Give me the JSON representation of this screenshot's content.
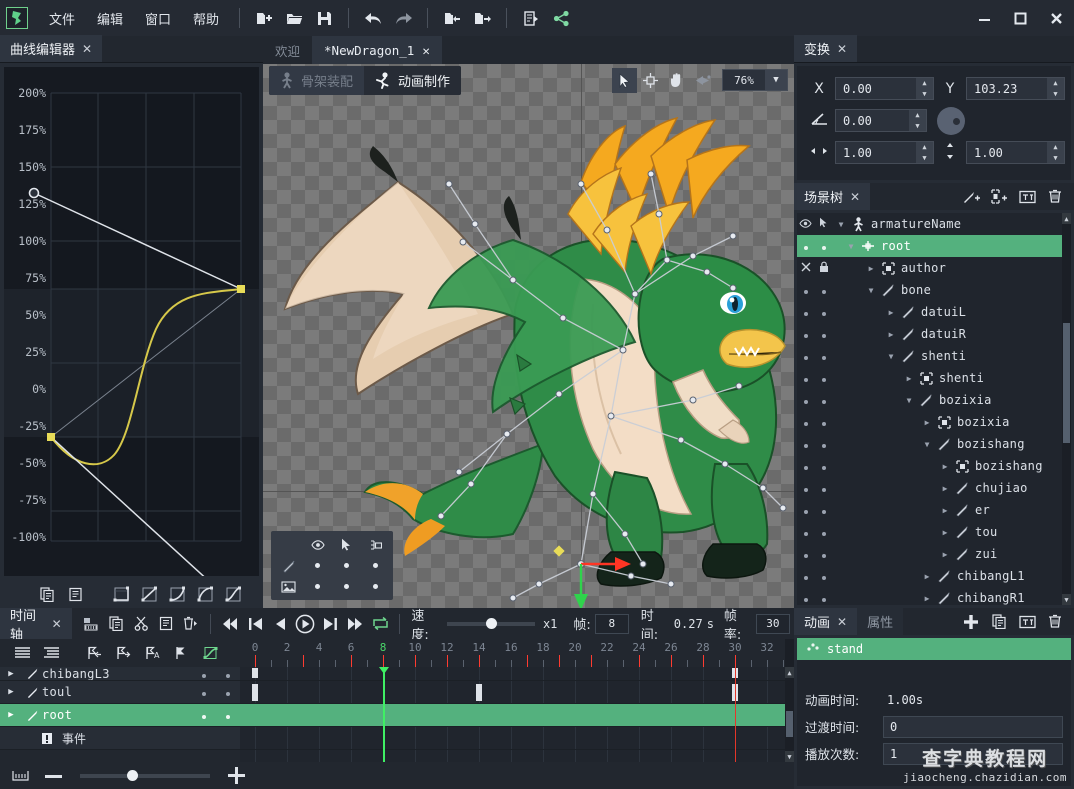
{
  "app": {
    "logo_icon": "dragonbones-logo-icon",
    "menus": [
      "文件",
      "编辑",
      "窗口",
      "帮助"
    ],
    "toolbar_icons": [
      "new-file-icon",
      "open-folder-icon",
      "save-icon",
      "undo-icon",
      "redo-icon",
      "import-icon",
      "export-icon",
      "export-document-icon",
      "share-icon"
    ],
    "window_controls": [
      "minimize",
      "maximize",
      "close"
    ]
  },
  "curve_editor": {
    "tab_label": "曲线编辑器",
    "close_icon": "close-icon",
    "y_ticks": [
      "200%",
      "175%",
      "150%",
      "125%",
      "100%",
      "75%",
      "50%",
      "25%",
      "0%",
      "-25%",
      "-50%",
      "-75%",
      "-100%"
    ],
    "toolbar_icons": [
      "copy-curve-icon",
      "paste-curve-icon",
      "linear-curve-icon",
      "ease-curve-icon",
      "ease-in-curve-icon",
      "ease-out-curve-icon",
      "ease-in-out-curve-icon"
    ],
    "handle_start_label": "150%",
    "handle_end_label": "-100%",
    "curve_color": "#d6c84a",
    "handle_color": "#d9dde3"
  },
  "center": {
    "doc_tabs": [
      {
        "label": "欢迎",
        "active": false,
        "closable": false
      },
      {
        "label": "*NewDragon_1",
        "active": true,
        "closable": true
      }
    ],
    "modes": [
      {
        "label": "骨架装配",
        "icon": "standing-person-icon",
        "active": false
      },
      {
        "label": "动画制作",
        "icon": "running-person-icon",
        "active": true
      }
    ],
    "view_tools": [
      {
        "icon": "pointer-icon",
        "selected": true
      },
      {
        "icon": "pivot-target-icon",
        "selected": false
      },
      {
        "icon": "hand-pan-icon",
        "selected": false
      },
      {
        "icon": "mesh-weight-icon",
        "selected": false
      }
    ],
    "zoom": "76%",
    "zoom_dropdown_icon": "chevron-down-icon",
    "overlay": {
      "columns": [
        "eye-visibility-icon",
        "pointer-select-icon",
        "tree-lock-icon"
      ],
      "rows": [
        "bone-icon",
        "image-icon"
      ]
    }
  },
  "transform": {
    "tab_label": "变换",
    "close_icon": "close-icon",
    "fields": [
      {
        "label": "X",
        "icon": "x-axis-icon",
        "value": "0.00"
      },
      {
        "label": "Y",
        "icon": "y-axis-icon",
        "value": "103.23"
      },
      {
        "label": "",
        "icon": "rotation-angle-icon",
        "value": "0.00"
      },
      {
        "label": "",
        "icon": "scale-x-icon",
        "value": "1.00"
      },
      {
        "label": "",
        "icon": "scale-y-icon",
        "value": "1.00"
      }
    ],
    "knob_icon": "rotation-knob-icon"
  },
  "scene_tree": {
    "tab_label": "场景树",
    "close_icon": "close-icon",
    "tools": [
      "add-bone-icon",
      "add-slot-icon",
      "add-text-icon",
      "delete-icon"
    ],
    "header": {
      "eye_icon": "eye-visibility-icon",
      "select_icon": "pointer-select-icon",
      "filter_icon": "chevron-down-icon",
      "armature_icon": "armature-icon",
      "name": "armatureName"
    },
    "nodes": [
      {
        "label": "root",
        "depth": 0,
        "icon": "root-transform-icon",
        "expanded": true,
        "selected": true,
        "visible": "dot",
        "locked": "dot"
      },
      {
        "label": "author",
        "depth": 1,
        "icon": "slot-icon",
        "expanded": false,
        "selected": false,
        "visible": "hidden",
        "locked": "locked"
      },
      {
        "label": "bone",
        "depth": 1,
        "icon": "bone-icon",
        "expanded": true,
        "selected": false,
        "visible": "dot",
        "locked": "dot"
      },
      {
        "label": "datuiL",
        "depth": 2,
        "icon": "bone-icon",
        "expanded": false,
        "selected": false,
        "visible": "dot",
        "locked": "dot"
      },
      {
        "label": "datuiR",
        "depth": 2,
        "icon": "bone-icon",
        "expanded": false,
        "selected": false,
        "visible": "dot",
        "locked": "dot"
      },
      {
        "label": "shenti",
        "depth": 2,
        "icon": "bone-icon",
        "expanded": true,
        "selected": false,
        "visible": "dot",
        "locked": "dot"
      },
      {
        "label": "shenti",
        "depth": 3,
        "icon": "slot-icon",
        "expanded": false,
        "selected": false,
        "visible": "dot",
        "locked": "dot"
      },
      {
        "label": "bozixia",
        "depth": 3,
        "icon": "bone-icon",
        "expanded": true,
        "selected": false,
        "visible": "dot",
        "locked": "dot"
      },
      {
        "label": "bozixia",
        "depth": 4,
        "icon": "slot-icon",
        "expanded": false,
        "selected": false,
        "visible": "dot",
        "locked": "dot"
      },
      {
        "label": "bozishang",
        "depth": 4,
        "icon": "bone-icon",
        "expanded": true,
        "selected": false,
        "visible": "dot",
        "locked": "dot"
      },
      {
        "label": "bozishang",
        "depth": 5,
        "icon": "slot-icon",
        "expanded": false,
        "selected": false,
        "visible": "dot",
        "locked": "dot"
      },
      {
        "label": "chujiao",
        "depth": 5,
        "icon": "bone-icon",
        "expanded": false,
        "selected": false,
        "visible": "dot",
        "locked": "dot"
      },
      {
        "label": "er",
        "depth": 5,
        "icon": "bone-icon",
        "expanded": false,
        "selected": false,
        "visible": "dot",
        "locked": "dot"
      },
      {
        "label": "tou",
        "depth": 5,
        "icon": "bone-icon",
        "expanded": false,
        "selected": false,
        "visible": "dot",
        "locked": "dot"
      },
      {
        "label": "zui",
        "depth": 5,
        "icon": "bone-icon",
        "expanded": false,
        "selected": false,
        "visible": "dot",
        "locked": "dot"
      },
      {
        "label": "chibangL1",
        "depth": 4,
        "icon": "bone-icon",
        "expanded": false,
        "selected": false,
        "visible": "dot",
        "locked": "dot"
      },
      {
        "label": "chibangR1",
        "depth": 4,
        "icon": "bone-icon",
        "expanded": false,
        "selected": false,
        "visible": "dot",
        "locked": "dot"
      }
    ]
  },
  "timeline": {
    "tab_label": "时间轴",
    "close_icon": "close-icon",
    "edit_tools": [
      "keyframe-tween-icon",
      "copy-icon",
      "cut-icon",
      "paste-icon",
      "delete-keys-icon"
    ],
    "transport": [
      "skip-to-start-icon",
      "prev-keyframe-icon",
      "step-back-icon",
      "play-icon",
      "step-forward-icon",
      "skip-to-end-icon",
      "loop-icon"
    ],
    "speed_label": "速度:",
    "speed_value": "x1",
    "frame_label": "帧:",
    "frame_value": "8",
    "time_label": "时间:",
    "time_value": "0.27",
    "time_unit": "s",
    "fps_label": "帧率:",
    "fps_value": "30",
    "left_tools": [
      "list-view-icon",
      "indent-view-icon",
      "prev-key-flag-icon",
      "next-key-flag-icon",
      "auto-key-flag-icon",
      "key-flag-icon",
      "curve-graph-icon"
    ],
    "ruler": {
      "ticks": [
        0,
        2,
        4,
        6,
        8,
        10,
        12,
        14,
        16,
        18,
        20,
        22,
        24,
        26,
        28,
        30,
        32
      ],
      "current_frame": 8,
      "max_frame": 33
    },
    "tracks": [
      {
        "name": "chibangL3",
        "selected": false,
        "keys": [
          0,
          30
        ],
        "dots": 2
      },
      {
        "name": "toul",
        "selected": false,
        "keys": [
          0,
          14,
          30
        ],
        "dots": 2
      },
      {
        "name": "root",
        "selected": true,
        "keys": [],
        "dots": 2
      }
    ],
    "event_row": {
      "label": "事件",
      "icon": "event-marker-icon"
    },
    "footer_icons": [
      "frame-range-icon",
      "zoom-out-icon",
      "zoom-in-icon"
    ]
  },
  "animation": {
    "tabs": [
      {
        "label": "动画",
        "active": true,
        "closable": true
      },
      {
        "label": "属性",
        "active": false,
        "closable": false
      }
    ],
    "tools": [
      "add-icon",
      "duplicate-icon",
      "rename-icon",
      "delete-icon"
    ],
    "items": [
      {
        "label": "stand",
        "icon": "animation-clip-icon",
        "selected": true
      }
    ],
    "properties": [
      {
        "label": "动画时间:",
        "value": "1.00s",
        "editable": false
      },
      {
        "label": "过渡时间:",
        "value": "0",
        "editable": true
      },
      {
        "label": "播放次数:",
        "value": "1",
        "editable": true
      }
    ]
  },
  "watermark": {
    "line1": "查字典教程网",
    "line2": "jiaocheng.chazidian.com"
  },
  "colors": {
    "accent_green": "#54b17e",
    "playhead_green": "#3ff064",
    "panel_bg": "#262c35",
    "field_bg": "#20252d",
    "curve_yellow": "#d6c84a",
    "keyframe_red": "#e4372a"
  }
}
